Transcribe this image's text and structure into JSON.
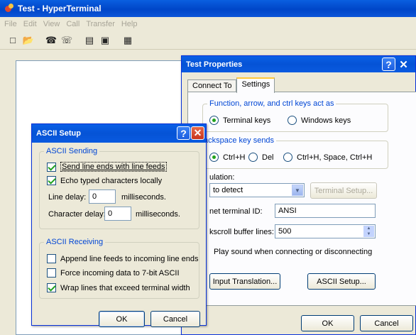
{
  "window": {
    "title": "Test - HyperTerminal"
  },
  "menu": [
    "File",
    "Edit",
    "View",
    "Call",
    "Transfer",
    "Help"
  ],
  "props": {
    "title": "Test Properties",
    "tabs": [
      "Connect To",
      "Settings"
    ],
    "fn_group": "Function, arrow, and ctrl keys act as",
    "fn_opt1": "Terminal keys",
    "fn_opt2": "Windows keys",
    "bs_group": "Backspace key sends",
    "bs_group_visible": "ackspace key sends",
    "bs_opt1": "Ctrl+H",
    "bs_opt2": "Del",
    "bs_opt3": "Ctrl+H, Space, Ctrl+H",
    "emulation_label": "ulation:",
    "emulation_value": "to detect",
    "terminal_setup": "Terminal Setup...",
    "telnet_label": "net terminal ID:",
    "telnet_value": "ANSI",
    "backscroll_label": "kscroll buffer lines:",
    "backscroll_value": "500",
    "play_sound": "Play sound when connecting or disconnecting",
    "input_translation": "Input Translation...",
    "ascii_setup": "ASCII Setup...",
    "ok": "OK",
    "cancel": "Cancel"
  },
  "ascii": {
    "title": "ASCII Setup",
    "sending_group": "ASCII Sending",
    "send_line_ends": "Send line ends with line feeds",
    "echo_typed": "Echo typed characters locally",
    "line_delay_label": "Line delay:",
    "line_delay_value": "0",
    "milliseconds": "milliseconds.",
    "char_delay_label": "Character delay:",
    "char_delay_value": "0",
    "receiving_group": "ASCII Receiving",
    "append_lf": "Append line feeds to incoming line ends",
    "force_7bit": "Force incoming data to 7-bit ASCII",
    "wrap_lines": "Wrap lines that exceed terminal width",
    "ok": "OK",
    "cancel": "Cancel"
  },
  "checks": {
    "send_line_ends": true,
    "echo_typed": true,
    "append_lf": false,
    "force_7bit": false,
    "wrap_lines": true
  }
}
